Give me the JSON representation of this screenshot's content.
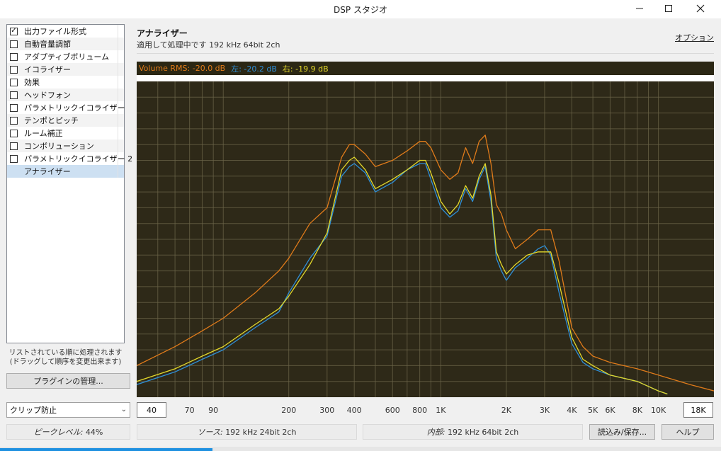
{
  "window": {
    "title": "DSP スタジオ"
  },
  "sidebar": {
    "items": [
      {
        "label": "出力ファイル形式",
        "checked": true,
        "has_checkbox": true
      },
      {
        "label": "自動音量調節",
        "checked": false,
        "has_checkbox": true
      },
      {
        "label": "アダプティブボリューム",
        "checked": false,
        "has_checkbox": true
      },
      {
        "label": "イコライザー",
        "checked": false,
        "has_checkbox": true
      },
      {
        "label": "効果",
        "checked": false,
        "has_checkbox": true
      },
      {
        "label": "ヘッドフォン",
        "checked": false,
        "has_checkbox": true
      },
      {
        "label": "パラメトリックイコライザー",
        "checked": false,
        "has_checkbox": true
      },
      {
        "label": "テンポとピッチ",
        "checked": false,
        "has_checkbox": true
      },
      {
        "label": "ルーム補正",
        "checked": false,
        "has_checkbox": true
      },
      {
        "label": "コンボリューション",
        "checked": false,
        "has_checkbox": true
      },
      {
        "label": "パラメトリックイコライザー 2",
        "checked": false,
        "has_checkbox": true
      },
      {
        "label": "アナライザー",
        "checked": false,
        "has_checkbox": false,
        "selected": true
      }
    ],
    "hint_line1": "リストされている順に処理されます",
    "hint_line2": "(ドラッグして順序を変更出来ます)",
    "plugin_button": "プラグインの管理...",
    "clip_select": "クリップ防止"
  },
  "panel": {
    "title": "アナライザー",
    "subtitle": "適用して処理中です 192 kHz 64bit 2ch",
    "options_link": "オプション"
  },
  "rms": {
    "volume_label": "Volume RMS: -20.0 dB",
    "left_label": "左: -20.2 dB",
    "right_label": "右: -19.9 dB"
  },
  "freq": {
    "min": "40",
    "max": "18K",
    "ticks": [
      "70",
      "90",
      "200",
      "300",
      "400",
      "600",
      "800",
      "1K",
      "2K",
      "3K",
      "4K",
      "5K",
      "6K",
      "8K",
      "10K"
    ]
  },
  "status": {
    "peak_label": "ピークレベル:",
    "peak_value": "44%",
    "source_label": "ソース:",
    "source_value": "192 kHz 24bit 2ch",
    "internal_label": "内部:",
    "internal_value": "192 kHz 64bit 2ch"
  },
  "buttons": {
    "load_save": "読込み/保存...",
    "help": "ヘルプ"
  },
  "chart_data": {
    "type": "line",
    "x_scale": "log",
    "xlim": [
      40,
      18000
    ],
    "grid": true,
    "colors": {
      "background": "#2e2918",
      "grid": "#6b6448",
      "volume": "#e07b1a",
      "left": "#2e8fd8",
      "right": "#e3d82a"
    },
    "series": [
      {
        "name": "Volume RMS",
        "x": [
          40,
          60,
          80,
          100,
          140,
          180,
          200,
          250,
          300,
          350,
          380,
          400,
          450,
          500,
          600,
          700,
          800,
          850,
          900,
          1000,
          1100,
          1200,
          1300,
          1400,
          1500,
          1600,
          1700,
          1800,
          1900,
          2000,
          2200,
          2500,
          2800,
          3000,
          3200,
          3500,
          4000,
          4500,
          5000,
          6000,
          8000,
          10000,
          14000,
          18000
        ],
        "level": [
          0.1,
          0.16,
          0.21,
          0.25,
          0.33,
          0.4,
          0.44,
          0.55,
          0.6,
          0.76,
          0.8,
          0.8,
          0.77,
          0.73,
          0.75,
          0.78,
          0.81,
          0.81,
          0.79,
          0.72,
          0.69,
          0.71,
          0.79,
          0.74,
          0.81,
          0.83,
          0.74,
          0.61,
          0.58,
          0.53,
          0.47,
          0.5,
          0.53,
          0.53,
          0.53,
          0.43,
          0.22,
          0.16,
          0.13,
          0.11,
          0.09,
          0.07,
          0.04,
          0.02
        ]
      },
      {
        "name": "左",
        "x": [
          40,
          60,
          80,
          100,
          140,
          180,
          200,
          250,
          300,
          350,
          380,
          400,
          450,
          500,
          600,
          700,
          800,
          850,
          900,
          1000,
          1100,
          1200,
          1300,
          1400,
          1500,
          1600,
          1700,
          1800,
          1900,
          2000,
          2200,
          2500,
          2800,
          3000,
          3200,
          3500,
          4000,
          4500,
          5000,
          6000,
          8000,
          10000,
          11000
        ],
        "level": [
          0.04,
          0.08,
          0.12,
          0.15,
          0.22,
          0.27,
          0.33,
          0.44,
          0.51,
          0.7,
          0.73,
          0.74,
          0.71,
          0.65,
          0.68,
          0.72,
          0.74,
          0.74,
          0.69,
          0.6,
          0.57,
          0.59,
          0.66,
          0.62,
          0.69,
          0.73,
          0.62,
          0.44,
          0.4,
          0.37,
          0.41,
          0.44,
          0.47,
          0.48,
          0.45,
          0.33,
          0.17,
          0.11,
          0.09,
          0.07,
          0.05,
          0.02,
          0.01
        ]
      },
      {
        "name": "右",
        "x": [
          40,
          60,
          80,
          100,
          140,
          180,
          200,
          250,
          300,
          350,
          380,
          400,
          450,
          500,
          600,
          700,
          800,
          850,
          900,
          1000,
          1100,
          1200,
          1300,
          1400,
          1500,
          1600,
          1700,
          1800,
          1900,
          2000,
          2200,
          2500,
          2800,
          3000,
          3200,
          3500,
          4000,
          4500,
          5000,
          6000,
          8000,
          10000,
          11000
        ],
        "level": [
          0.05,
          0.09,
          0.13,
          0.16,
          0.23,
          0.28,
          0.32,
          0.42,
          0.52,
          0.72,
          0.75,
          0.76,
          0.72,
          0.66,
          0.69,
          0.72,
          0.75,
          0.75,
          0.71,
          0.62,
          0.58,
          0.61,
          0.67,
          0.63,
          0.7,
          0.74,
          0.64,
          0.46,
          0.42,
          0.39,
          0.42,
          0.45,
          0.46,
          0.46,
          0.46,
          0.36,
          0.19,
          0.12,
          0.1,
          0.07,
          0.05,
          0.02,
          0.01
        ]
      }
    ]
  }
}
